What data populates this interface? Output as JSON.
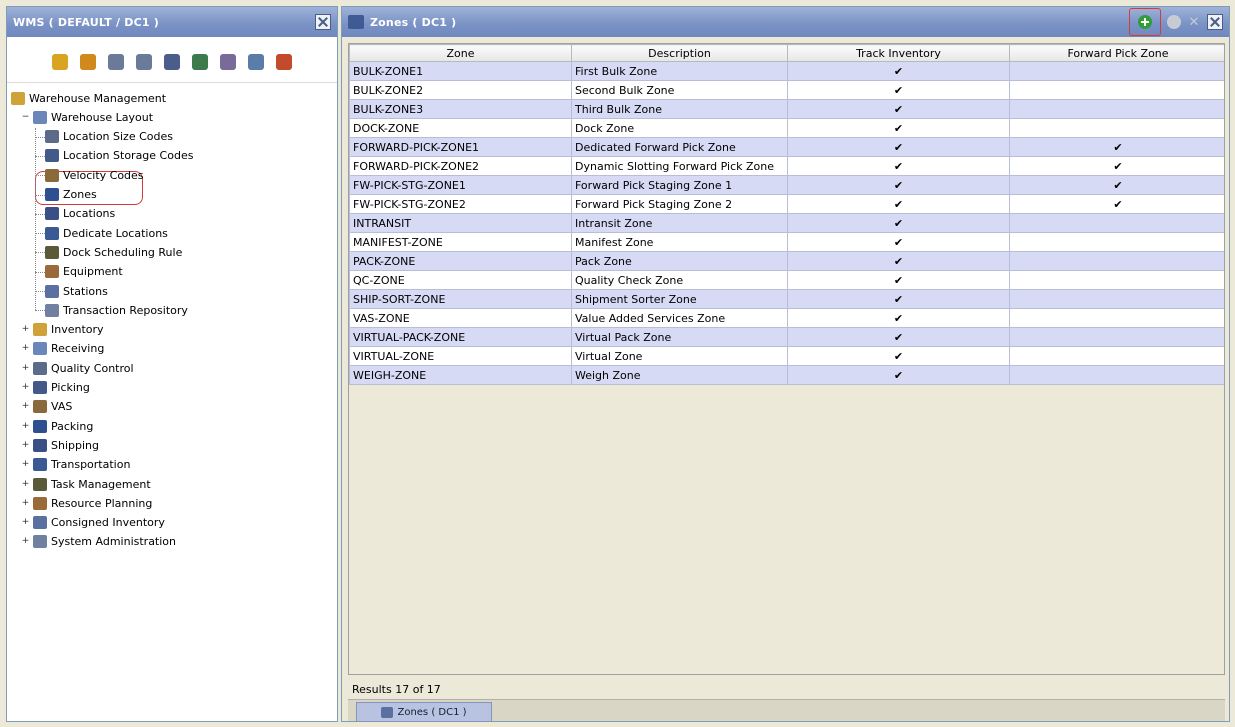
{
  "left": {
    "title": "WMS ( DEFAULT / DC1 )",
    "toolbar_icons": [
      "gear-icon",
      "wrench-icon",
      "vehicle-icon",
      "vehicle2-icon",
      "document-icon",
      "truck-icon",
      "people-icon",
      "clipboard-icon",
      "arrow-icon"
    ],
    "tree": [
      {
        "label": "Warehouse Management",
        "icon": "warehouse-icon",
        "level": 0,
        "expander": ""
      },
      {
        "label": "Warehouse Layout",
        "icon": "layout-icon",
        "level": 1,
        "expander": "−"
      },
      {
        "label": "Location Size Codes",
        "icon": "sizecode-icon",
        "level": 2
      },
      {
        "label": "Location Storage Codes",
        "icon": "storage-icon",
        "level": 2
      },
      {
        "label": "Velocity Codes",
        "icon": "velocity-icon",
        "level": 2
      },
      {
        "label": "Zones",
        "icon": "zone-icon",
        "level": 2
      },
      {
        "label": "Locations",
        "icon": "location-icon",
        "level": 2
      },
      {
        "label": "Dedicate Locations",
        "icon": "dedicate-icon",
        "level": 2
      },
      {
        "label": "Dock Scheduling Rule",
        "icon": "dock-icon",
        "level": 2
      },
      {
        "label": "Equipment",
        "icon": "equipment-icon",
        "level": 2
      },
      {
        "label": "Stations",
        "icon": "stations-icon",
        "level": 2
      },
      {
        "label": "Transaction Repository",
        "icon": "repository-icon",
        "level": 2
      },
      {
        "label": "Inventory",
        "icon": "inventory-icon",
        "level": 1,
        "expander": "+"
      },
      {
        "label": "Receiving",
        "icon": "receiving-icon",
        "level": 1,
        "expander": "+"
      },
      {
        "label": "Quality Control",
        "icon": "quality-icon",
        "level": 1,
        "expander": "+"
      },
      {
        "label": "Picking",
        "icon": "picking-icon",
        "level": 1,
        "expander": "+"
      },
      {
        "label": "VAS",
        "icon": "vas-icon",
        "level": 1,
        "expander": "+"
      },
      {
        "label": "Packing",
        "icon": "packing-icon",
        "level": 1,
        "expander": "+"
      },
      {
        "label": "Shipping",
        "icon": "shipping-icon",
        "level": 1,
        "expander": "+"
      },
      {
        "label": "Transportation",
        "icon": "transport-icon",
        "level": 1,
        "expander": "+"
      },
      {
        "label": "Task Management",
        "icon": "task-icon",
        "level": 1,
        "expander": "+"
      },
      {
        "label": "Resource Planning",
        "icon": "resource-icon",
        "level": 1,
        "expander": "+"
      },
      {
        "label": "Consigned Inventory",
        "icon": "consigned-icon",
        "level": 1,
        "expander": "+"
      },
      {
        "label": "System Administration",
        "icon": "sysadmin-icon",
        "level": 1,
        "expander": "+"
      }
    ]
  },
  "right": {
    "title": "Zones ( DC1 )",
    "columns": [
      "Zone",
      "Description",
      "Track Inventory",
      "Forward Pick Zone"
    ],
    "rows": [
      {
        "zone": "BULK-ZONE1",
        "desc": "First Bulk Zone",
        "track": "✔",
        "fwd": ""
      },
      {
        "zone": "BULK-ZONE2",
        "desc": "Second Bulk Zone",
        "track": "✔",
        "fwd": ""
      },
      {
        "zone": "BULK-ZONE3",
        "desc": "Third Bulk Zone",
        "track": "✔",
        "fwd": ""
      },
      {
        "zone": "DOCK-ZONE",
        "desc": "Dock Zone",
        "track": "✔",
        "fwd": ""
      },
      {
        "zone": "FORWARD-PICK-ZONE1",
        "desc": "Dedicated Forward Pick Zone",
        "track": "✔",
        "fwd": "✔"
      },
      {
        "zone": "FORWARD-PICK-ZONE2",
        "desc": "Dynamic Slotting Forward Pick Zone",
        "track": "✔",
        "fwd": "✔"
      },
      {
        "zone": "FW-PICK-STG-ZONE1",
        "desc": "Forward Pick Staging Zone 1",
        "track": "✔",
        "fwd": "✔"
      },
      {
        "zone": "FW-PICK-STG-ZONE2",
        "desc": "Forward Pick Staging Zone 2",
        "track": "✔",
        "fwd": "✔"
      },
      {
        "zone": "INTRANSIT",
        "desc": "Intransit Zone",
        "track": "✔",
        "fwd": ""
      },
      {
        "zone": "MANIFEST-ZONE",
        "desc": "Manifest Zone",
        "track": "✔",
        "fwd": ""
      },
      {
        "zone": "PACK-ZONE",
        "desc": "Pack Zone",
        "track": "✔",
        "fwd": ""
      },
      {
        "zone": "QC-ZONE",
        "desc": "Quality Check Zone",
        "track": "✔",
        "fwd": ""
      },
      {
        "zone": "SHIP-SORT-ZONE",
        "desc": "Shipment Sorter Zone",
        "track": "✔",
        "fwd": ""
      },
      {
        "zone": "VAS-ZONE",
        "desc": "Value Added Services Zone",
        "track": "✔",
        "fwd": ""
      },
      {
        "zone": "VIRTUAL-PACK-ZONE",
        "desc": "Virtual Pack Zone",
        "track": "✔",
        "fwd": ""
      },
      {
        "zone": "VIRTUAL-ZONE",
        "desc": "Virtual Zone",
        "track": "✔",
        "fwd": ""
      },
      {
        "zone": "WEIGH-ZONE",
        "desc": "Weigh Zone",
        "track": "✔",
        "fwd": ""
      }
    ],
    "results_text": "Results 17 of 17",
    "bottom_tab": "Zones ( DC1 )"
  },
  "colors": {
    "titlebar": "#7b93c6",
    "row_alt": "#d6daf5",
    "highlight": "#d23c3c",
    "add_green": "#2f9e3a"
  }
}
